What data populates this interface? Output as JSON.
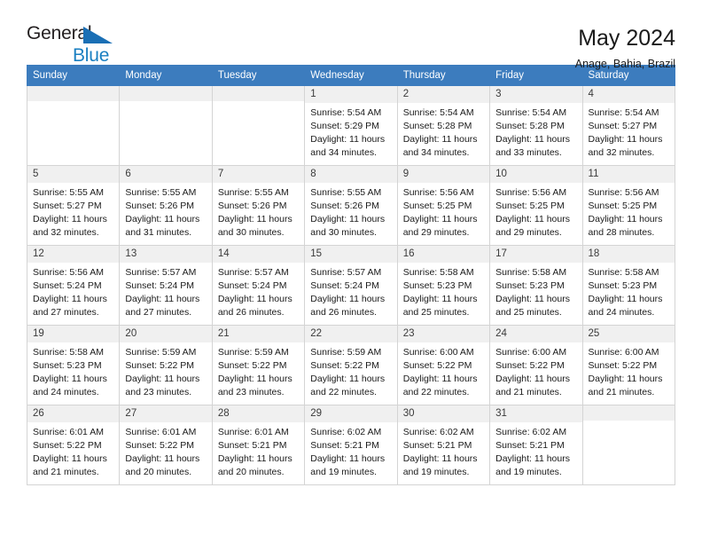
{
  "logo": {
    "word1": "General",
    "word2": "Blue",
    "triangle_color": "#1a6fb5",
    "word2_color": "#1a7fc1"
  },
  "header": {
    "title": "May 2024",
    "subtitle": "Anage, Bahia, Brazil",
    "header_bg": "#3c7cbe",
    "header_text_color": "#ffffff"
  },
  "weekdays": [
    "Sunday",
    "Monday",
    "Tuesday",
    "Wednesday",
    "Thursday",
    "Friday",
    "Saturday"
  ],
  "labels": {
    "sunrise": "Sunrise:",
    "sunset": "Sunset:",
    "daylight": "Daylight:"
  },
  "weeks": [
    [
      {
        "day": "",
        "empty": true
      },
      {
        "day": "",
        "empty": true
      },
      {
        "day": "",
        "empty": true
      },
      {
        "day": "1",
        "sunrise": "Sunrise: 5:54 AM",
        "sunset": "Sunset: 5:29 PM",
        "daylight1": "Daylight: 11 hours",
        "daylight2": "and 34 minutes."
      },
      {
        "day": "2",
        "sunrise": "Sunrise: 5:54 AM",
        "sunset": "Sunset: 5:28 PM",
        "daylight1": "Daylight: 11 hours",
        "daylight2": "and 34 minutes."
      },
      {
        "day": "3",
        "sunrise": "Sunrise: 5:54 AM",
        "sunset": "Sunset: 5:28 PM",
        "daylight1": "Daylight: 11 hours",
        "daylight2": "and 33 minutes."
      },
      {
        "day": "4",
        "sunrise": "Sunrise: 5:54 AM",
        "sunset": "Sunset: 5:27 PM",
        "daylight1": "Daylight: 11 hours",
        "daylight2": "and 32 minutes."
      }
    ],
    [
      {
        "day": "5",
        "sunrise": "Sunrise: 5:55 AM",
        "sunset": "Sunset: 5:27 PM",
        "daylight1": "Daylight: 11 hours",
        "daylight2": "and 32 minutes."
      },
      {
        "day": "6",
        "sunrise": "Sunrise: 5:55 AM",
        "sunset": "Sunset: 5:26 PM",
        "daylight1": "Daylight: 11 hours",
        "daylight2": "and 31 minutes."
      },
      {
        "day": "7",
        "sunrise": "Sunrise: 5:55 AM",
        "sunset": "Sunset: 5:26 PM",
        "daylight1": "Daylight: 11 hours",
        "daylight2": "and 30 minutes."
      },
      {
        "day": "8",
        "sunrise": "Sunrise: 5:55 AM",
        "sunset": "Sunset: 5:26 PM",
        "daylight1": "Daylight: 11 hours",
        "daylight2": "and 30 minutes."
      },
      {
        "day": "9",
        "sunrise": "Sunrise: 5:56 AM",
        "sunset": "Sunset: 5:25 PM",
        "daylight1": "Daylight: 11 hours",
        "daylight2": "and 29 minutes."
      },
      {
        "day": "10",
        "sunrise": "Sunrise: 5:56 AM",
        "sunset": "Sunset: 5:25 PM",
        "daylight1": "Daylight: 11 hours",
        "daylight2": "and 29 minutes."
      },
      {
        "day": "11",
        "sunrise": "Sunrise: 5:56 AM",
        "sunset": "Sunset: 5:25 PM",
        "daylight1": "Daylight: 11 hours",
        "daylight2": "and 28 minutes."
      }
    ],
    [
      {
        "day": "12",
        "sunrise": "Sunrise: 5:56 AM",
        "sunset": "Sunset: 5:24 PM",
        "daylight1": "Daylight: 11 hours",
        "daylight2": "and 27 minutes."
      },
      {
        "day": "13",
        "sunrise": "Sunrise: 5:57 AM",
        "sunset": "Sunset: 5:24 PM",
        "daylight1": "Daylight: 11 hours",
        "daylight2": "and 27 minutes."
      },
      {
        "day": "14",
        "sunrise": "Sunrise: 5:57 AM",
        "sunset": "Sunset: 5:24 PM",
        "daylight1": "Daylight: 11 hours",
        "daylight2": "and 26 minutes."
      },
      {
        "day": "15",
        "sunrise": "Sunrise: 5:57 AM",
        "sunset": "Sunset: 5:24 PM",
        "daylight1": "Daylight: 11 hours",
        "daylight2": "and 26 minutes."
      },
      {
        "day": "16",
        "sunrise": "Sunrise: 5:58 AM",
        "sunset": "Sunset: 5:23 PM",
        "daylight1": "Daylight: 11 hours",
        "daylight2": "and 25 minutes."
      },
      {
        "day": "17",
        "sunrise": "Sunrise: 5:58 AM",
        "sunset": "Sunset: 5:23 PM",
        "daylight1": "Daylight: 11 hours",
        "daylight2": "and 25 minutes."
      },
      {
        "day": "18",
        "sunrise": "Sunrise: 5:58 AM",
        "sunset": "Sunset: 5:23 PM",
        "daylight1": "Daylight: 11 hours",
        "daylight2": "and 24 minutes."
      }
    ],
    [
      {
        "day": "19",
        "sunrise": "Sunrise: 5:58 AM",
        "sunset": "Sunset: 5:23 PM",
        "daylight1": "Daylight: 11 hours",
        "daylight2": "and 24 minutes."
      },
      {
        "day": "20",
        "sunrise": "Sunrise: 5:59 AM",
        "sunset": "Sunset: 5:22 PM",
        "daylight1": "Daylight: 11 hours",
        "daylight2": "and 23 minutes."
      },
      {
        "day": "21",
        "sunrise": "Sunrise: 5:59 AM",
        "sunset": "Sunset: 5:22 PM",
        "daylight1": "Daylight: 11 hours",
        "daylight2": "and 23 minutes."
      },
      {
        "day": "22",
        "sunrise": "Sunrise: 5:59 AM",
        "sunset": "Sunset: 5:22 PM",
        "daylight1": "Daylight: 11 hours",
        "daylight2": "and 22 minutes."
      },
      {
        "day": "23",
        "sunrise": "Sunrise: 6:00 AM",
        "sunset": "Sunset: 5:22 PM",
        "daylight1": "Daylight: 11 hours",
        "daylight2": "and 22 minutes."
      },
      {
        "day": "24",
        "sunrise": "Sunrise: 6:00 AM",
        "sunset": "Sunset: 5:22 PM",
        "daylight1": "Daylight: 11 hours",
        "daylight2": "and 21 minutes."
      },
      {
        "day": "25",
        "sunrise": "Sunrise: 6:00 AM",
        "sunset": "Sunset: 5:22 PM",
        "daylight1": "Daylight: 11 hours",
        "daylight2": "and 21 minutes."
      }
    ],
    [
      {
        "day": "26",
        "sunrise": "Sunrise: 6:01 AM",
        "sunset": "Sunset: 5:22 PM",
        "daylight1": "Daylight: 11 hours",
        "daylight2": "and 21 minutes."
      },
      {
        "day": "27",
        "sunrise": "Sunrise: 6:01 AM",
        "sunset": "Sunset: 5:22 PM",
        "daylight1": "Daylight: 11 hours",
        "daylight2": "and 20 minutes."
      },
      {
        "day": "28",
        "sunrise": "Sunrise: 6:01 AM",
        "sunset": "Sunset: 5:21 PM",
        "daylight1": "Daylight: 11 hours",
        "daylight2": "and 20 minutes."
      },
      {
        "day": "29",
        "sunrise": "Sunrise: 6:02 AM",
        "sunset": "Sunset: 5:21 PM",
        "daylight1": "Daylight: 11 hours",
        "daylight2": "and 19 minutes."
      },
      {
        "day": "30",
        "sunrise": "Sunrise: 6:02 AM",
        "sunset": "Sunset: 5:21 PM",
        "daylight1": "Daylight: 11 hours",
        "daylight2": "and 19 minutes."
      },
      {
        "day": "31",
        "sunrise": "Sunrise: 6:02 AM",
        "sunset": "Sunset: 5:21 PM",
        "daylight1": "Daylight: 11 hours",
        "daylight2": "and 19 minutes."
      },
      {
        "day": "",
        "empty": true
      }
    ]
  ]
}
